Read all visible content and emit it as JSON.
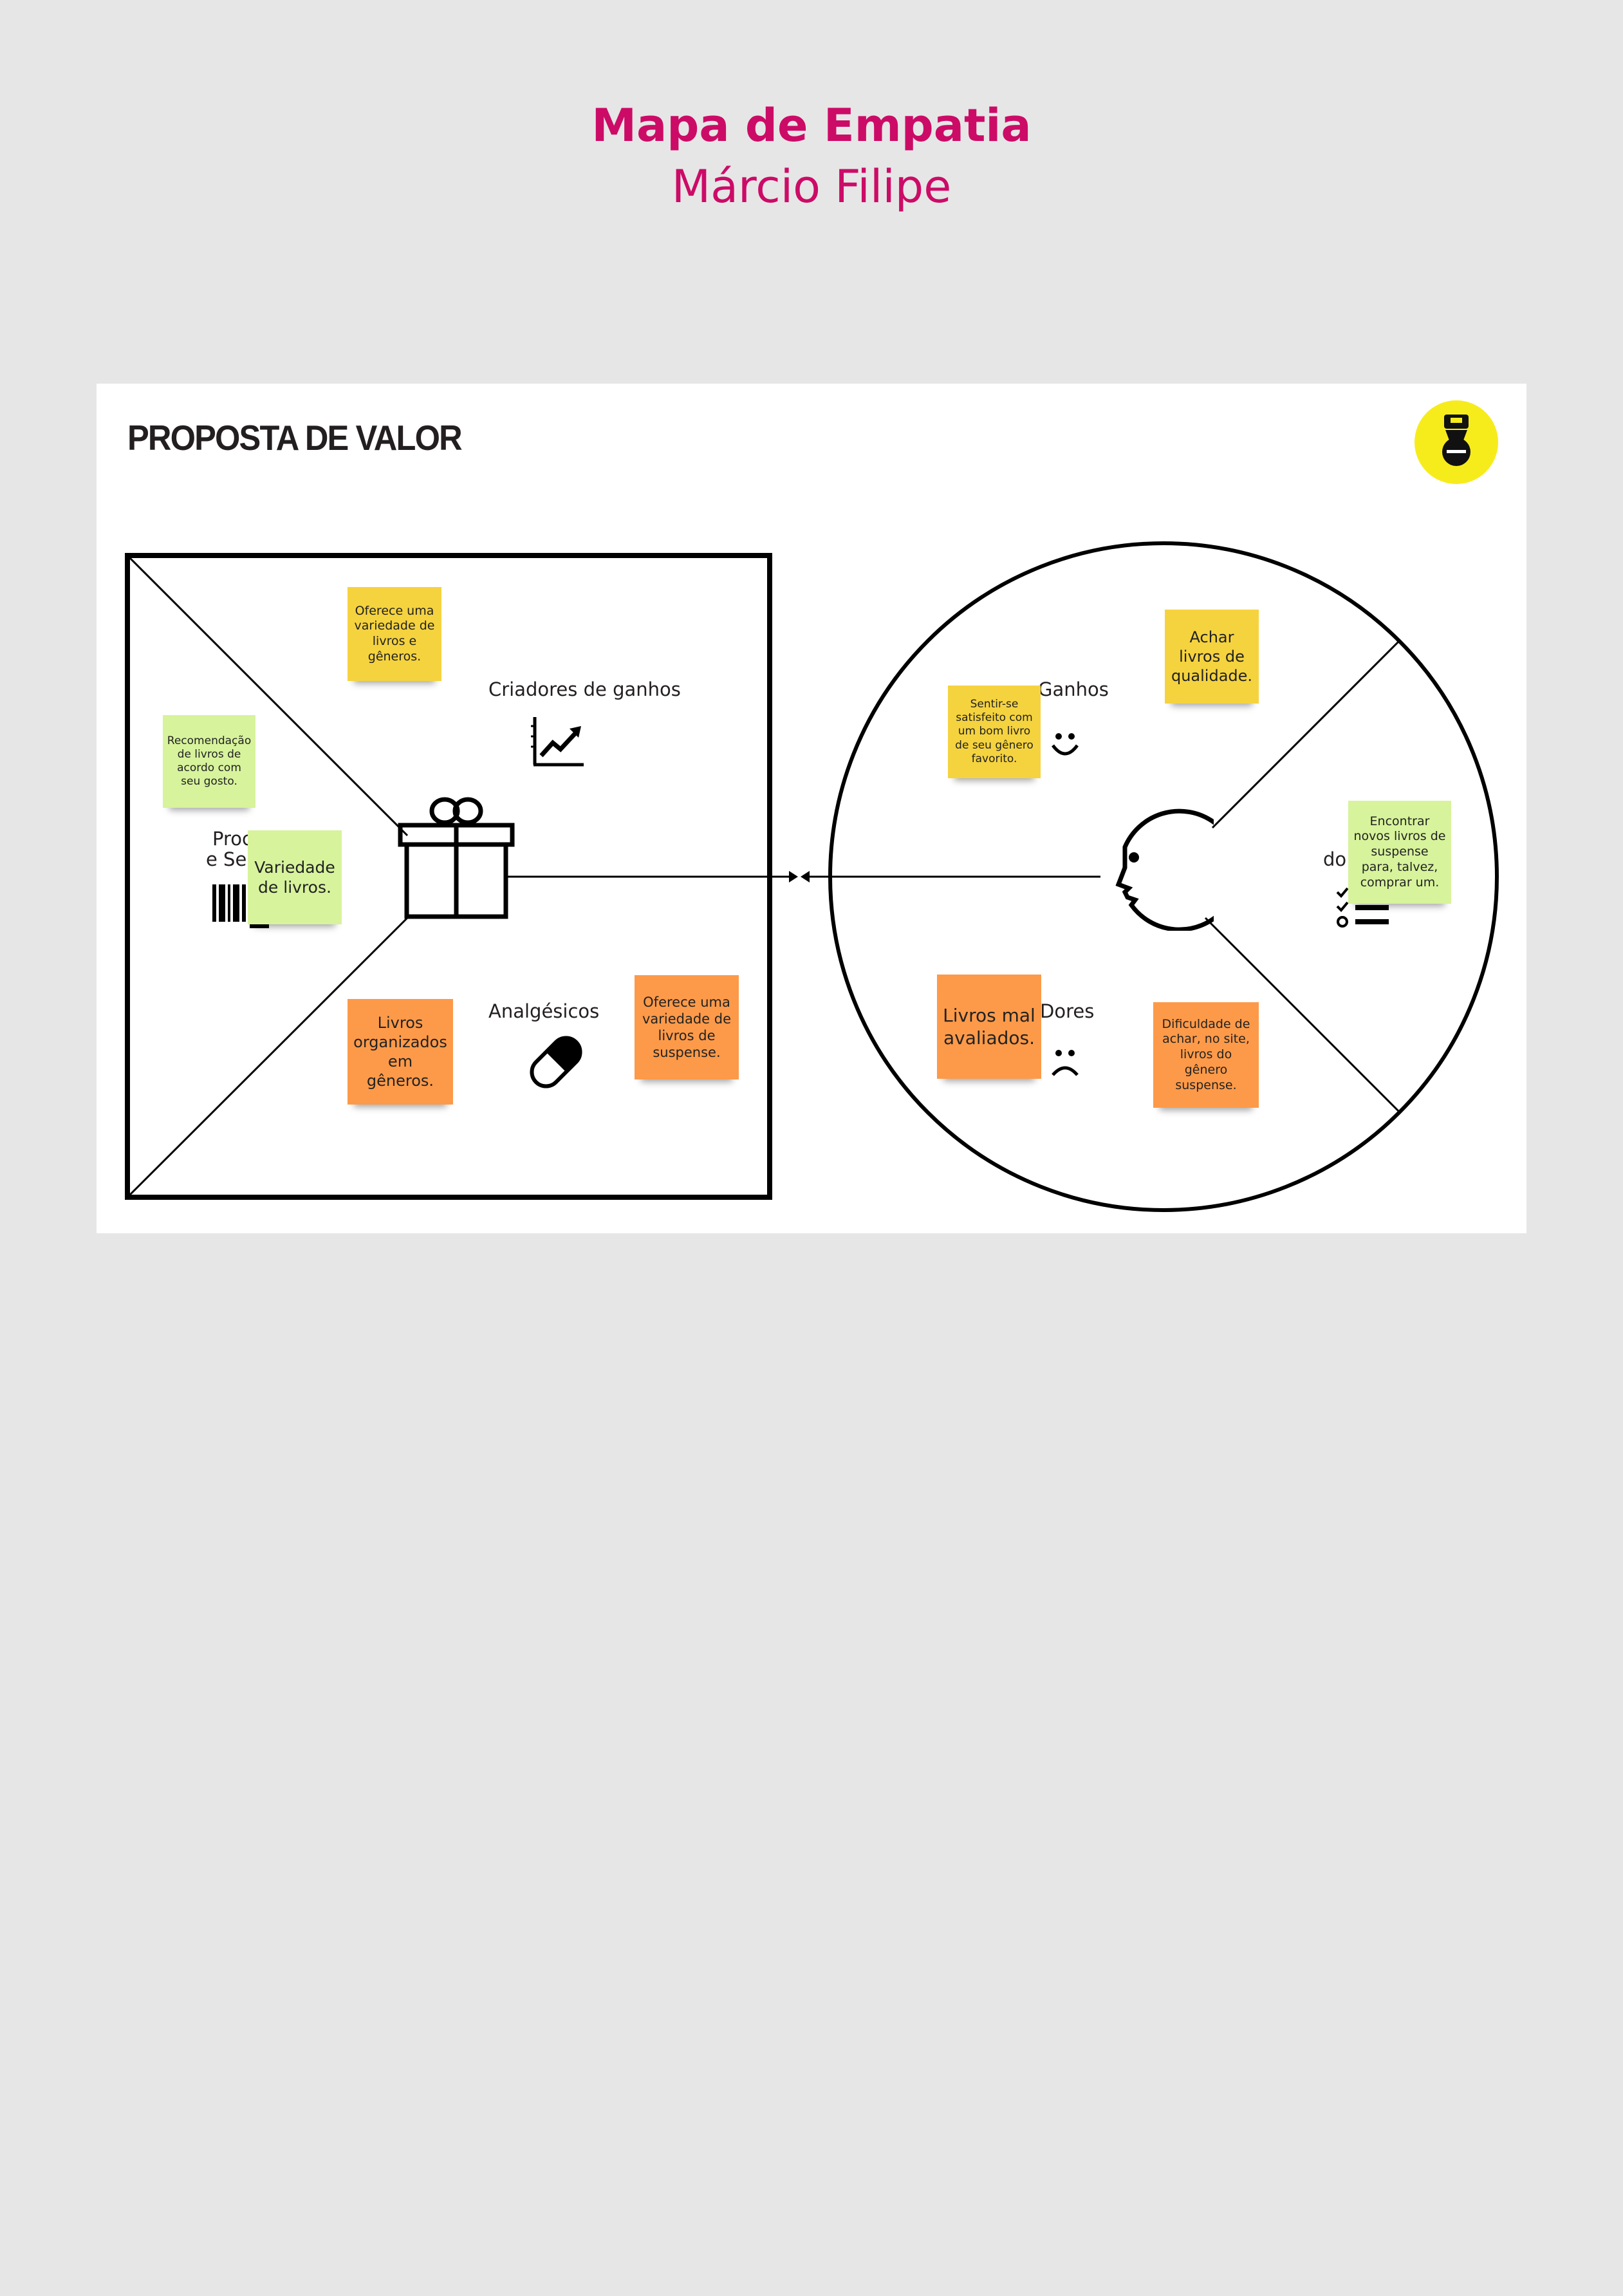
{
  "header": {
    "title": "Mapa de Empatia",
    "subtitle": "Márcio Filipe"
  },
  "board": {
    "heading": "PROPOSTA DE VALOR",
    "logo_icon": "academy-logo-icon",
    "labels": {
      "gain_creators": "Criadores de ganhos",
      "products_line1": "Proc",
      "products_line2": "e Ser",
      "pain_relievers": "Analgésicos",
      "gains": "Ganhos",
      "pains": "Dores",
      "jobs": "do"
    },
    "icons": [
      "chart-up-icon",
      "gift-icon",
      "barcode-icon",
      "pill-icon",
      "face-icon",
      "smile-icon",
      "frown-icon",
      "checklist-icon",
      "arrow-icon"
    ]
  },
  "notes": [
    {
      "id": "n1",
      "color": "#f5d33f",
      "text": "Oferece uma variedade de livros e gêneros."
    },
    {
      "id": "n2",
      "color": "#d7f39c",
      "text": "Recomendação de livros de acordo com seu gosto."
    },
    {
      "id": "n3",
      "color": "#d7f39c",
      "text": "Variedade de livros."
    },
    {
      "id": "n4",
      "color": "#fd9a49",
      "text": "Livros organizados em gêneros."
    },
    {
      "id": "n5",
      "color": "#fd9a49",
      "text": "Oferece uma variedade de livros de suspense."
    },
    {
      "id": "n6",
      "color": "#f5d33f",
      "text": "Achar livros de qualidade."
    },
    {
      "id": "n7",
      "color": "#f5d33f",
      "text": "Sentir-se satisfeito com um bom livro de seu gênero favorito."
    },
    {
      "id": "n8",
      "color": "#d7f39c",
      "text": "Encontrar novos livros de suspense para, talvez, comprar um."
    },
    {
      "id": "n9",
      "color": "#fd9a49",
      "text": "Livros mal avaliados."
    },
    {
      "id": "n10",
      "color": "#fd9a49",
      "text": "Dificuldade de achar, no site, livros do gênero suspense."
    }
  ]
}
